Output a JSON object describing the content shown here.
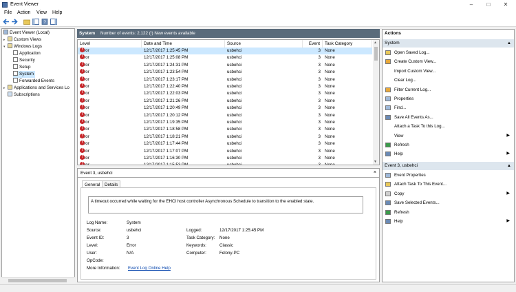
{
  "window": {
    "title": "Event Viewer"
  },
  "menu": [
    "File",
    "Action",
    "View",
    "Help"
  ],
  "tree": {
    "root": "Event Viewer (Local)",
    "custom_views": "Custom Views",
    "windows_logs": "Windows Logs",
    "logs": [
      "Application",
      "Security",
      "Setup",
      "System",
      "Forwarded Events"
    ],
    "apps_services": "Applications and Services Lo",
    "subscriptions": "Subscriptions"
  },
  "center": {
    "title": "System",
    "subtitle": "Number of events: 2,122 (!) New events available",
    "columns": [
      "Level",
      "Date and Time",
      "Source",
      "Event ID",
      "Task Category"
    ],
    "rows": [
      [
        "Error",
        "12/17/2017 1:25:45 PM",
        "usbehci",
        "3",
        "None"
      ],
      [
        "Error",
        "12/17/2017 1:25:08 PM",
        "usbehci",
        "3",
        "None"
      ],
      [
        "Error",
        "12/17/2017 1:24:31 PM",
        "usbehci",
        "3",
        "None"
      ],
      [
        "Error",
        "12/17/2017 1:23:54 PM",
        "usbehci",
        "3",
        "None"
      ],
      [
        "Error",
        "12/17/2017 1:23:17 PM",
        "usbehci",
        "3",
        "None"
      ],
      [
        "Error",
        "12/17/2017 1:22:40 PM",
        "usbehci",
        "3",
        "None"
      ],
      [
        "Error",
        "12/17/2017 1:22:03 PM",
        "usbehci",
        "3",
        "None"
      ],
      [
        "Error",
        "12/17/2017 1:21:26 PM",
        "usbehci",
        "3",
        "None"
      ],
      [
        "Error",
        "12/17/2017 1:20:49 PM",
        "usbehci",
        "3",
        "None"
      ],
      [
        "Error",
        "12/17/2017 1:20:12 PM",
        "usbehci",
        "3",
        "None"
      ],
      [
        "Error",
        "12/17/2017 1:19:35 PM",
        "usbehci",
        "3",
        "None"
      ],
      [
        "Error",
        "12/17/2017 1:18:58 PM",
        "usbehci",
        "3",
        "None"
      ],
      [
        "Error",
        "12/17/2017 1:18:21 PM",
        "usbehci",
        "3",
        "None"
      ],
      [
        "Error",
        "12/17/2017 1:17:44 PM",
        "usbehci",
        "3",
        "None"
      ],
      [
        "Error",
        "12/17/2017 1:17:07 PM",
        "usbehci",
        "3",
        "None"
      ],
      [
        "Error",
        "12/17/2017 1:16:30 PM",
        "usbehci",
        "3",
        "None"
      ],
      [
        "Error",
        "12/17/2017 1:15:53 PM",
        "usbehci",
        "3",
        "None"
      ]
    ]
  },
  "detail": {
    "header": "Event 3, usbehci",
    "close": "×",
    "tabs": [
      "General",
      "Details"
    ],
    "message": "A timeout occurred while waiting for the EHCI host controller Asynchronous Schedule to transition to the enabled state.",
    "log_name_label": "Log Name:",
    "log_name": "System",
    "source_label": "Source:",
    "source": "usbehci",
    "logged_label": "Logged:",
    "logged": "12/17/2017 1:25:45 PM",
    "event_id_label": "Event ID:",
    "event_id": "3",
    "task_category_label": "Task Category:",
    "task_category": "None",
    "level_label": "Level:",
    "level": "Error",
    "keywords_label": "Keywords:",
    "keywords": "Classic",
    "user_label": "User:",
    "user": "N/A",
    "computer_label": "Computer:",
    "computer": "Felony-PC",
    "opcode_label": "OpCode:",
    "more_info_label": "More Information:",
    "more_info_link": "Event Log Online Help"
  },
  "actions": {
    "title": "Actions",
    "system_section": "System",
    "system_items": [
      "Open Saved Log...",
      "Create Custom View...",
      "Import Custom View...",
      "Clear Log...",
      "Filter Current Log...",
      "Properties",
      "Find...",
      "Save All Events As...",
      "Attach a Task To this Log...",
      "View",
      "Refresh",
      "Help"
    ],
    "event_section": "Event 3, usbehci",
    "event_items": [
      "Event Properties",
      "Attach Task To This Event...",
      "Copy",
      "Save Selected Events...",
      "Refresh",
      "Help"
    ]
  },
  "colors": {
    "error": "#c8262a",
    "selection": "#cce8ff",
    "header_bar": "#5a6b7b",
    "section": "#dde6ee"
  }
}
